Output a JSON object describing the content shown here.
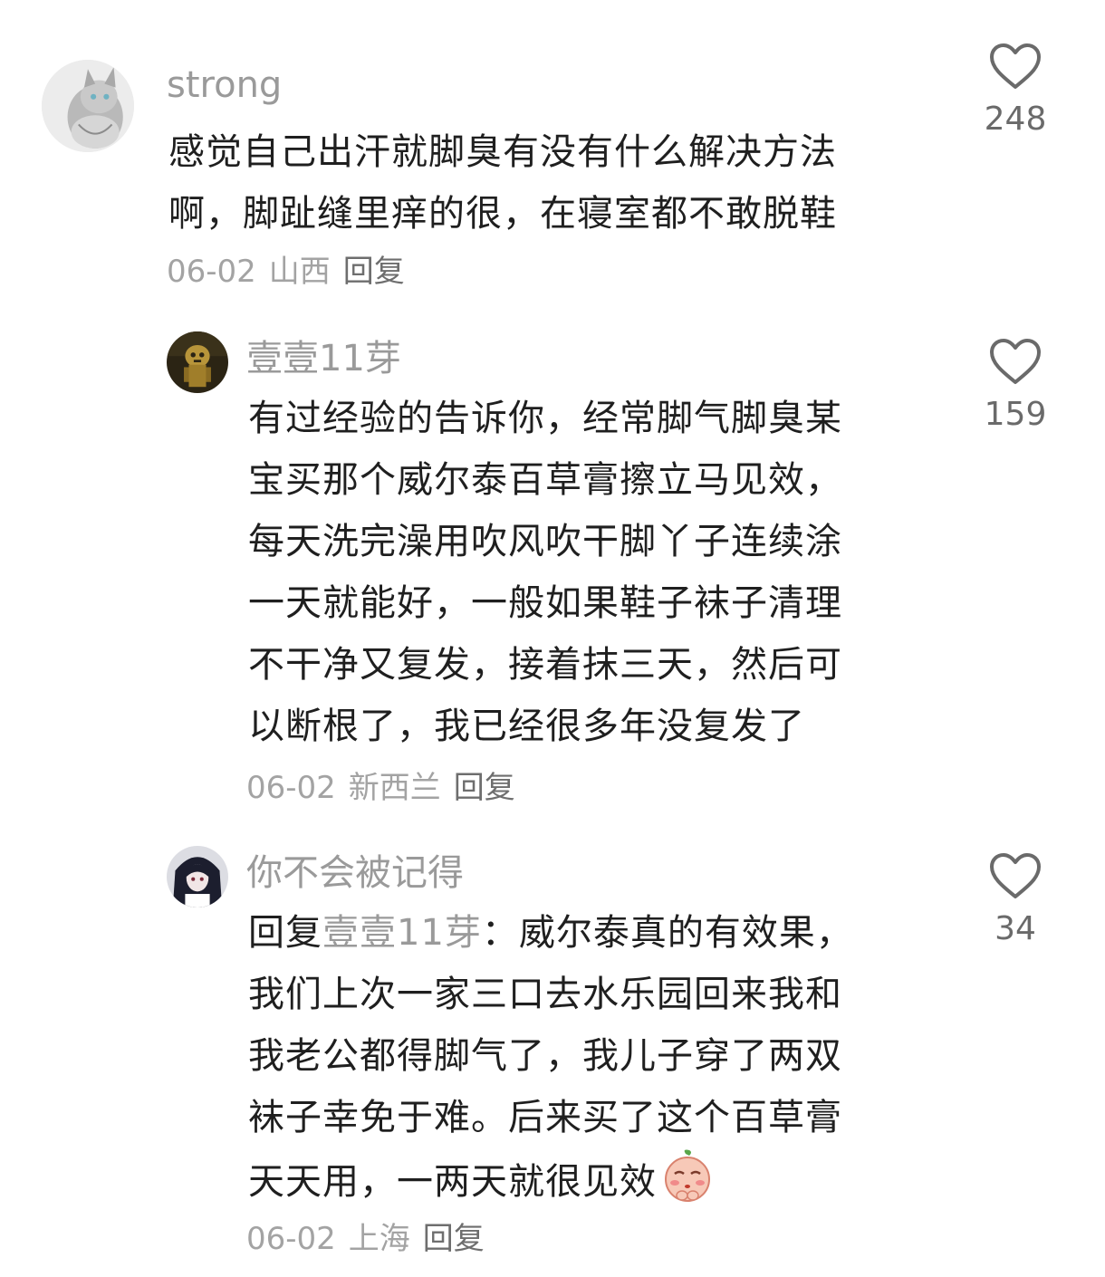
{
  "comments": [
    {
      "username": "strong",
      "lines": [
        "感觉自己出汗就脚臭有没有什么解决方法",
        "啊，脚趾缝里痒的很，在寝室都不敢脱鞋"
      ],
      "date": "06-02",
      "location": "山西",
      "reply_label": "回复",
      "likes": "248"
    },
    {
      "username": "壹壹11芽",
      "lines": [
        "有过经验的告诉你，经常脚气脚臭某",
        "宝买那个威尔泰百草膏擦立马见效，",
        "每天洗完澡用吹风吹干脚丫子连续涂",
        "一天就能好，一般如果鞋子袜子清理",
        "不干净又复发，接着抹三天，然后可",
        "以断根了，我已经很多年没复发了"
      ],
      "date": "06-02",
      "location": "新西兰",
      "reply_label": "回复",
      "likes": "159"
    },
    {
      "username": "你不会被记得",
      "reply_prefix": "回复",
      "reply_to": "壹壹11芽",
      "first_line_rest": "：威尔泰真的有效果，",
      "lines": [
        "我们上次一家三口去水乐园回来我和",
        "我老公都得脚气了，我儿子穿了两双",
        "袜子幸免于难。后来买了这个百草膏",
        "天天用，一两天就很见效"
      ],
      "emoji": "shy-face-emoji",
      "date": "06-02",
      "location": "上海",
      "reply_label": "回复",
      "likes": "34"
    }
  ]
}
